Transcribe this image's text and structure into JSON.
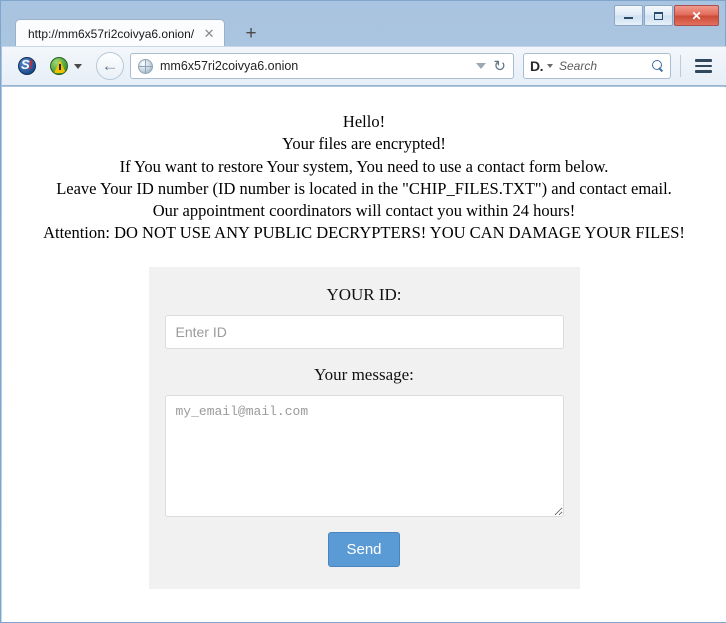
{
  "window": {
    "minimize_label": "Minimize",
    "maximize_label": "Restore",
    "close_label": "Close",
    "close_glyph": "✕"
  },
  "tabs": {
    "items": [
      {
        "title": "http://mm6x57ri2coivya6.onion/",
        "close_glyph": "✕"
      }
    ],
    "new_tab_glyph": "+"
  },
  "toolbar": {
    "back_glyph": "←",
    "url": "mm6x57ri2coivya6.onion",
    "url_dropdown": "",
    "reload_glyph": "↻",
    "search_engine": "D.",
    "search_placeholder": "Search",
    "noscript_letter": "S",
    "noscript_bang": "!"
  },
  "page": {
    "notice_lines": [
      "Hello!",
      "Your files are encrypted!",
      "If You want to restore Your system, You need to use a contact form below.",
      "Leave Your ID number (ID number is located in the \"CHIP_FILES.TXT\") and contact email.",
      "Our appointment coordinators will contact you within 24 hours!",
      "Attention: DO NOT USE ANY PUBLIC DECRYPTERS! YOU CAN DAMAGE YOUR FILES!"
    ],
    "form": {
      "id_label": "YOUR ID:",
      "id_value": "",
      "id_placeholder": "Enter ID",
      "message_label": "Your message:",
      "message_value": "",
      "message_placeholder": "my_email@mail.com",
      "send_label": "Send"
    }
  },
  "colors": {
    "accent_button": "#5b9bd5",
    "panel_bg": "#f1f1f1",
    "page_bg": "#ffffff",
    "chrome_frame": "#a9c4e0"
  }
}
